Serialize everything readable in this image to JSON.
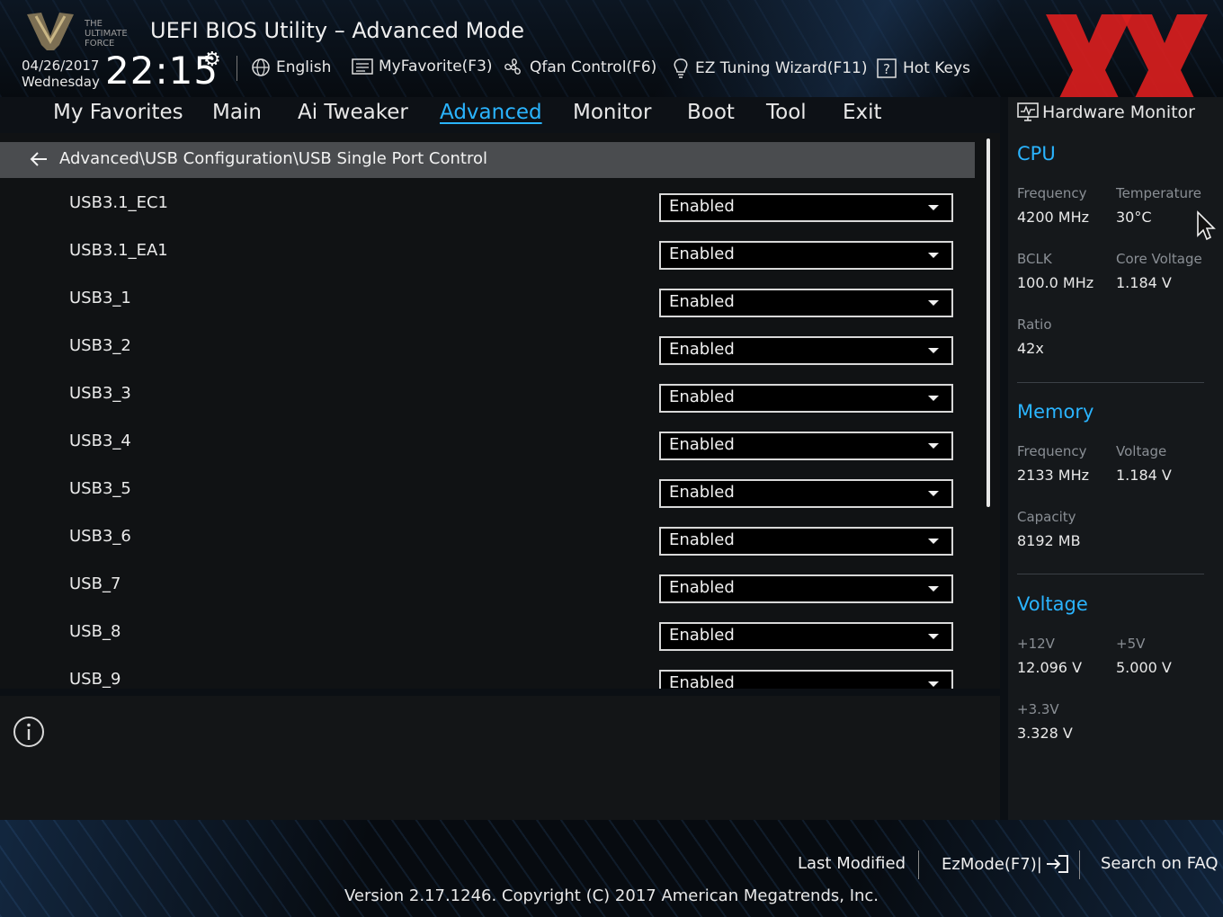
{
  "header": {
    "title": "UEFI BIOS Utility – Advanced Mode",
    "logo_text": [
      "THE",
      "ULTIMATE",
      "FORCE"
    ],
    "date": "04/26/2017",
    "weekday": "Wednesday",
    "time": "22:15",
    "tools": [
      {
        "label": "English",
        "icon": "globe-icon"
      },
      {
        "label": "MyFavorite(F3)",
        "icon": "favorite-list-icon"
      },
      {
        "label": "Qfan Control(F6)",
        "icon": "fan-icon"
      },
      {
        "label": "EZ Tuning Wizard(F11)",
        "icon": "lightbulb-icon"
      },
      {
        "label": "Hot Keys",
        "icon": "help-icon"
      }
    ]
  },
  "tabs": [
    {
      "label": "My Favorites"
    },
    {
      "label": "Main"
    },
    {
      "label": "Ai Tweaker"
    },
    {
      "label": "Advanced",
      "active": true
    },
    {
      "label": "Monitor"
    },
    {
      "label": "Boot"
    },
    {
      "label": "Tool"
    },
    {
      "label": "Exit"
    }
  ],
  "breadcrumb": "Advanced\\USB Configuration\\USB Single Port Control",
  "settings": [
    {
      "label": "USB3.1_EC1",
      "value": "Enabled"
    },
    {
      "label": "USB3.1_EA1",
      "value": "Enabled"
    },
    {
      "label": "USB3_1",
      "value": "Enabled"
    },
    {
      "label": "USB3_2",
      "value": "Enabled"
    },
    {
      "label": "USB3_3",
      "value": "Enabled"
    },
    {
      "label": "USB3_4",
      "value": "Enabled"
    },
    {
      "label": "USB3_5",
      "value": "Enabled"
    },
    {
      "label": "USB3_6",
      "value": "Enabled"
    },
    {
      "label": "USB_7",
      "value": "Enabled"
    },
    {
      "label": "USB_8",
      "value": "Enabled"
    },
    {
      "label": "USB_9",
      "value": "Enabled"
    }
  ],
  "hardware_monitor": {
    "title": "Hardware Monitor",
    "cpu": {
      "heading": "CPU",
      "frequency_label": "Frequency",
      "frequency": "4200 MHz",
      "temperature_label": "Temperature",
      "temperature": "30°C",
      "bclk_label": "BCLK",
      "bclk": "100.0 MHz",
      "core_voltage_label": "Core Voltage",
      "core_voltage": "1.184 V",
      "ratio_label": "Ratio",
      "ratio": "42x"
    },
    "memory": {
      "heading": "Memory",
      "frequency_label": "Frequency",
      "frequency": "2133 MHz",
      "voltage_label": "Voltage",
      "voltage": "1.184 V",
      "capacity_label": "Capacity",
      "capacity": "8192 MB"
    },
    "voltage": {
      "heading": "Voltage",
      "v12_label": "+12V",
      "v12": "12.096 V",
      "v5_label": "+5V",
      "v5": "5.000 V",
      "v33_label": "+3.3V",
      "v33": "3.328 V"
    }
  },
  "footer": {
    "last_modified": "Last Modified",
    "ezmode": "EzMode(F7)|",
    "search_faq": "Search on FAQ",
    "version": "Version 2.17.1246. Copyright (C) 2017 American Megatrends, Inc."
  },
  "colors": {
    "accent": "#2ab4ff",
    "watermark": "#d81e1e",
    "breadcrumb_bg": "#4a4c4f"
  }
}
